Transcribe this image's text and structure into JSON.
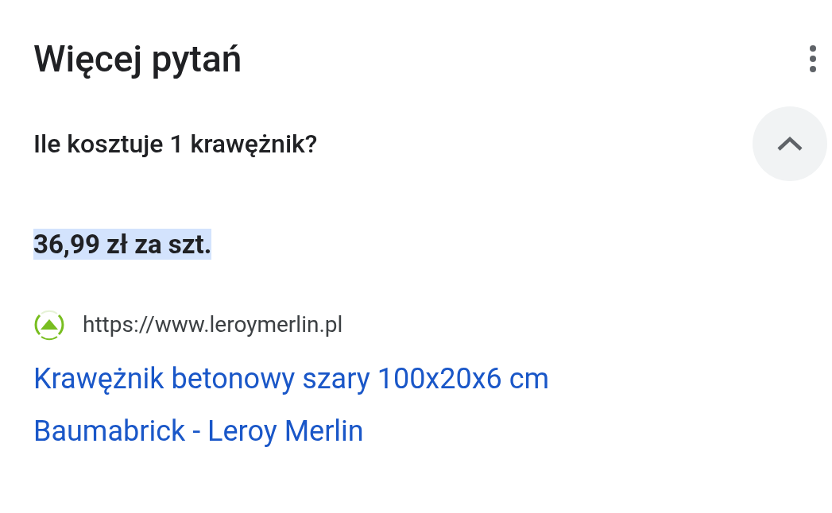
{
  "title": "Więcej pytań",
  "question": {
    "text": "Ile kosztuje 1 krawężnik?",
    "expanded": true
  },
  "answer": {
    "text": "36,99 zł za szt.",
    "highlighted": true
  },
  "source": {
    "url": "https://www.leroymerlin.pl",
    "link_lines": [
      "Krawężnik betonowy szary 100x20x6 cm",
      "Baumabrick - Leroy Merlin"
    ]
  }
}
